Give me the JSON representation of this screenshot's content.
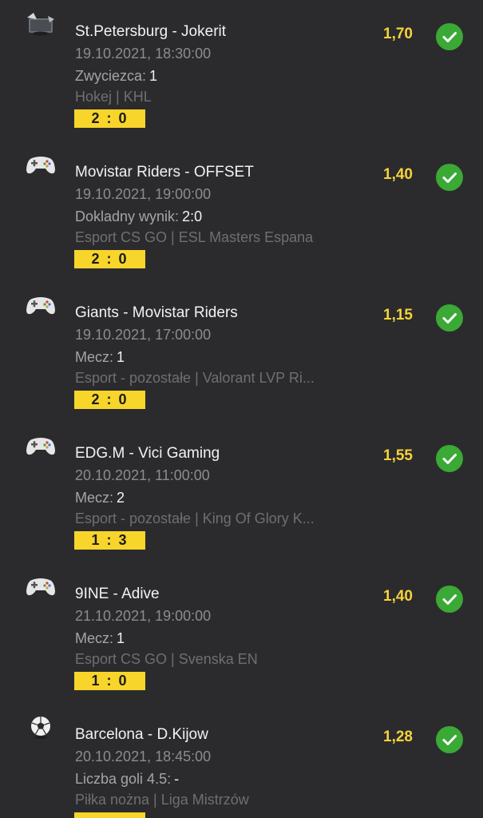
{
  "bets": [
    {
      "icon": "hockey-icon",
      "title": "St.Petersburg - Jokerit",
      "date": "19.10.2021, 18:30:00",
      "market_label": "Zwyciezca:",
      "market_pick": "1",
      "league": "Hokej | KHL",
      "score": "2 : 0",
      "odds": "1,70",
      "status": "won"
    },
    {
      "icon": "gamepad-icon",
      "title": "Movistar Riders - OFFSET",
      "date": "19.10.2021, 19:00:00",
      "market_label": "Dokladny wynik:",
      "market_pick": "2:0",
      "league": "Esport CS GO | ESL Masters Espana",
      "score": "2 : 0",
      "odds": "1,40",
      "status": "won"
    },
    {
      "icon": "gamepad-icon",
      "title": "Giants - Movistar Riders",
      "date": "19.10.2021, 17:00:00",
      "market_label": "Mecz:",
      "market_pick": "1",
      "league": "Esport - pozostałe | Valorant LVP Ri...",
      "score": "2 : 0",
      "odds": "1,15",
      "status": "won"
    },
    {
      "icon": "gamepad-icon",
      "title": "EDG.M - Vici Gaming",
      "date": "20.10.2021, 11:00:00",
      "market_label": "Mecz:",
      "market_pick": "2",
      "league": "Esport - pozostałe | King Of Glory K...",
      "score": "1 : 3",
      "odds": "1,55",
      "status": "won"
    },
    {
      "icon": "gamepad-icon",
      "title": "9INE - Adive",
      "date": "21.10.2021, 19:00:00",
      "market_label": "Mecz:",
      "market_pick": "1",
      "league": "Esport CS GO | Svenska EN",
      "score": "1 : 0",
      "odds": "1,40",
      "status": "won"
    },
    {
      "icon": "football-icon",
      "title": "Barcelona - D.Kijow",
      "date": "20.10.2021, 18:45:00",
      "market_label": "Liczba goli 4.5:",
      "market_pick": "-",
      "league": "Piłka nożna | Liga Mistrzów",
      "score": "",
      "odds": "1,28",
      "status": "won"
    }
  ],
  "colors": {
    "background": "#2b2b2d",
    "odds": "#f5d33a",
    "score_badge": "#f7d52b",
    "won_check": "#3aa935"
  }
}
